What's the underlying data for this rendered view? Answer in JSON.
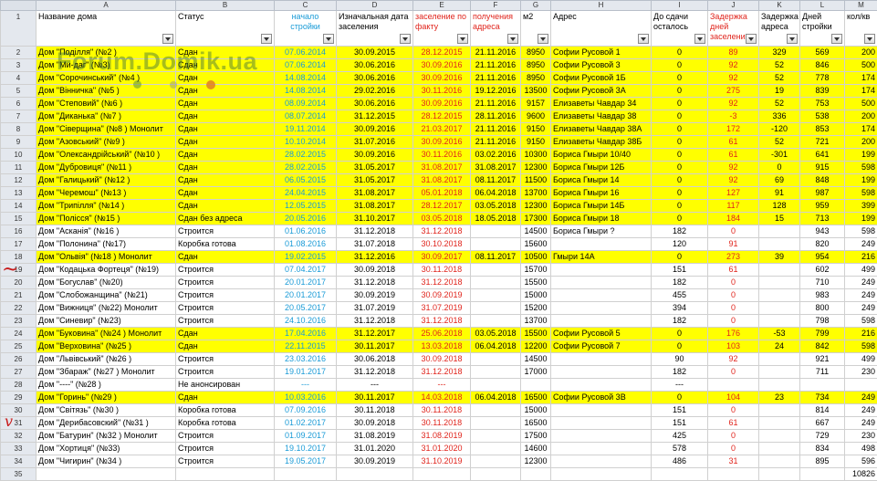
{
  "columns": [
    "A",
    "B",
    "C",
    "D",
    "E",
    "F",
    "G",
    "H",
    "I",
    "J",
    "K",
    "L",
    "M"
  ],
  "headers": [
    "Название дома",
    "Статус",
    "начало стройки",
    "Изначальная дата заселения",
    "заселение по факту",
    "получения адреса",
    "м2",
    "Адрес",
    "До сдачи осталось",
    "Задержка дней заселения",
    "Задержка адреса",
    "Дней стройки",
    "кол/кв"
  ],
  "header_row_number": "1",
  "rows": [
    {
      "n": "2",
      "hl": true,
      "c": [
        "Дом \"Поділля\" (№2 )",
        "Сдан",
        "07.06.2014",
        "30.09.2015",
        "28.12.2015",
        "21.11.2016",
        "8950",
        "Софии Русовой 1",
        "0",
        "89",
        "329",
        "569",
        "200"
      ]
    },
    {
      "n": "3",
      "hl": true,
      "c": [
        "Дом \"Ми-даг\" (№3)",
        "Сдан",
        "07.06.2014",
        "30.06.2016",
        "30.09.2016",
        "21.11.2016",
        "8950",
        "Софии Русовой 3",
        "0",
        "92",
        "52",
        "846",
        "500"
      ]
    },
    {
      "n": "4",
      "hl": true,
      "c": [
        "Дом \"Сорочинський\" (№4 )",
        "Сдан",
        "14.08.2014",
        "30.06.2016",
        "30.09.2016",
        "21.11.2016",
        "8950",
        "Софии Русовой 1Б",
        "0",
        "92",
        "52",
        "778",
        "174"
      ]
    },
    {
      "n": "5",
      "hl": true,
      "c": [
        "Дом \"Вінничка\" (№5 )",
        "Сдан",
        "14.08.2014",
        "29.02.2016",
        "30.11.2016",
        "19.12.2016",
        "13500",
        "Софии Русовой 3А",
        "0",
        "275",
        "19",
        "839",
        "174"
      ]
    },
    {
      "n": "6",
      "hl": true,
      "c": [
        "Дом \"Степовий\" (№6 )",
        "Сдан",
        "08.09.2014",
        "30.06.2016",
        "30.09.2016",
        "21.11.2016",
        "9157",
        "Елизаветы Чавдар 34",
        "0",
        "92",
        "52",
        "753",
        "500"
      ]
    },
    {
      "n": "7",
      "hl": true,
      "c": [
        "Дом \"Диканька\" (№7 )",
        "Сдан",
        "08.07.2014",
        "31.12.2015",
        "28.12.2015",
        "28.11.2016",
        "9600",
        "Елизаветы Чавдар 38",
        "0",
        "-3",
        "336",
        "538",
        "200"
      ]
    },
    {
      "n": "8",
      "hl": true,
      "c": [
        "Дом \"Сіверщина\" (№8 ) Монолит",
        "Сдан",
        "19.11.2014",
        "30.09.2016",
        "21.03.2017",
        "21.11.2016",
        "9150",
        "Елизаветы Чавдар 38А",
        "0",
        "172",
        "-120",
        "853",
        "174"
      ]
    },
    {
      "n": "9",
      "hl": true,
      "c": [
        "Дом \"Азовський\" (№9 )",
        "Сдан",
        "10.10.2014",
        "31.07.2016",
        "30.09.2016",
        "21.11.2016",
        "9150",
        "Елизаветы Чавдар 38Б",
        "0",
        "61",
        "52",
        "721",
        "200"
      ]
    },
    {
      "n": "10",
      "hl": true,
      "c": [
        "Дом \"Олександрійський\" (№10 )",
        "Сдан",
        "28.02.2015",
        "30.09.2016",
        "30.11.2016",
        "03.02.2016",
        "10300",
        "Бориса Гмыри 10/40",
        "0",
        "61",
        "-301",
        "641",
        "199"
      ]
    },
    {
      "n": "11",
      "hl": true,
      "c": [
        "Дом \"Дубровиця\" (№11 )",
        "Сдан",
        "28.02.2015",
        "31.05.2017",
        "31.08.2017",
        "31.08.2017",
        "12300",
        "Бориса Гмыри 12Б",
        "0",
        "92",
        "0",
        "915",
        "598"
      ]
    },
    {
      "n": "12",
      "hl": true,
      "c": [
        "Дом \"Галицький\" (№12 )",
        "Сдан",
        "06.05.2015",
        "31.05.2017",
        "31.08.2017",
        "08.11.2017",
        "11500",
        "Бориса Гмыри 14",
        "0",
        "92",
        "69",
        "848",
        "199"
      ]
    },
    {
      "n": "13",
      "hl": true,
      "c": [
        "Дом \"Черемош\" (№13 )",
        "Сдан",
        "24.04.2015",
        "31.08.2017",
        "05.01.2018",
        "06.04.2018",
        "13700",
        "Бориса Гмыри 16",
        "0",
        "127",
        "91",
        "987",
        "598"
      ]
    },
    {
      "n": "14",
      "hl": true,
      "c": [
        "Дом \"Трипілля\" (№14 )",
        "Сдан",
        "12.05.2015",
        "31.08.2017",
        "28.12.2017",
        "03.05.2018",
        "12300",
        "Бориса Гмыри 14Б",
        "0",
        "117",
        "128",
        "959",
        "399"
      ]
    },
    {
      "n": "15",
      "hl": true,
      "c": [
        "Дом \"Полісся\" (№15 )",
        "Сдан без адреса",
        "20.05.2016",
        "31.10.2017",
        "03.05.2018",
        "18.05.2018",
        "17300",
        "Бориса Гмыри 18",
        "0",
        "184",
        "15",
        "713",
        "199"
      ]
    },
    {
      "n": "16",
      "hl": false,
      "c": [
        "Дом \"Асканія\" (№16 )",
        "Строится",
        "01.06.2016",
        "31.12.2018",
        "31.12.2018",
        "",
        "14500",
        "Бориса Гмыри ?",
        "182",
        "0",
        "",
        "943",
        "598"
      ]
    },
    {
      "n": "17",
      "hl": false,
      "c": [
        "Дом \"Полонина\" (№17)",
        "Коробка готова",
        "01.08.2016",
        "31.07.2018",
        "30.10.2018",
        "",
        "15600",
        "",
        "120",
        "91",
        "",
        "820",
        "249"
      ]
    },
    {
      "n": "18",
      "hl": true,
      "c": [
        "Дом \"Ольвія\" (№18 ) Монолит",
        "Сдан",
        "19.02.2015",
        "31.12.2016",
        "30.09.2017",
        "08.11.2017",
        "10500",
        "Гмыри 14А",
        "0",
        "273",
        "39",
        "954",
        "216"
      ]
    },
    {
      "n": "19",
      "hl": false,
      "c": [
        "Дом \"Кодацька Фортеця\" (№19)",
        "Строится",
        "07.04.2017",
        "30.09.2018",
        "30.11.2018",
        "",
        "15700",
        "",
        "151",
        "61",
        "",
        "602",
        "499"
      ]
    },
    {
      "n": "20",
      "hl": false,
      "c": [
        "Дом \"Богуслав\" (№20)",
        "Строится",
        "20.01.2017",
        "31.12.2018",
        "31.12.2018",
        "",
        "15500",
        "",
        "182",
        "0",
        "",
        "710",
        "249"
      ]
    },
    {
      "n": "21",
      "hl": false,
      "c": [
        "Дом \"Слобожанщина\" (№21)",
        "Строится",
        "20.01.2017",
        "30.09.2019",
        "30.09.2019",
        "",
        "15000",
        "",
        "455",
        "0",
        "",
        "983",
        "249"
      ]
    },
    {
      "n": "22",
      "hl": false,
      "c": [
        "Дом \"Вижниця\" (№22) Монолит",
        "Строится",
        "20.05.2017",
        "31.07.2019",
        "31.07.2019",
        "",
        "15200",
        "",
        "394",
        "0",
        "",
        "800",
        "249"
      ]
    },
    {
      "n": "23",
      "hl": false,
      "c": [
        "Дом \"Синевир\" (№23)",
        "Строится",
        "24.10.2016",
        "31.12.2018",
        "31.12.2018",
        "",
        "13700",
        "",
        "182",
        "0",
        "",
        "798",
        "598"
      ]
    },
    {
      "n": "24",
      "hl": true,
      "c": [
        "Дом \"Буковина\" (№24 ) Монолит",
        "Сдан",
        "17.04.2016",
        "31.12.2017",
        "25.06.2018",
        "03.05.2018",
        "15500",
        "Софии Русовой 5",
        "0",
        "176",
        "-53",
        "799",
        "216"
      ]
    },
    {
      "n": "25",
      "hl": true,
      "c": [
        "Дом \"Верховина\" (№25 )",
        "Сдан",
        "22.11.2015",
        "30.11.2017",
        "13.03.2018",
        "06.04.2018",
        "12200",
        "Софии Русовой 7",
        "0",
        "103",
        "24",
        "842",
        "598"
      ]
    },
    {
      "n": "26",
      "hl": false,
      "c": [
        "Дом \"Львівський\" (№26 )",
        "Строится",
        "23.03.2016",
        "30.06.2018",
        "30.09.2018",
        "",
        "14500",
        "",
        "90",
        "92",
        "",
        "921",
        "499"
      ]
    },
    {
      "n": "27",
      "hl": false,
      "c": [
        "Дом \"Збараж\" (№27 ) Монолит",
        "Строится",
        "19.01.2017",
        "31.12.2018",
        "31.12.2018",
        "",
        "17000",
        "",
        "182",
        "0",
        "",
        "711",
        "230"
      ]
    },
    {
      "n": "28",
      "hl": false,
      "c": [
        "Дом \"----\" (№28 )",
        "Не анонсирован",
        "---",
        "---",
        "---",
        "",
        "",
        "",
        "---",
        "",
        "",
        "",
        ""
      ]
    },
    {
      "n": "29",
      "hl": true,
      "c": [
        "Дом \"Горинь\" (№29 )",
        "Сдан",
        "10.03.2016",
        "30.11.2017",
        "14.03.2018",
        "06.04.2018",
        "16500",
        "Софии Русовой 3В",
        "0",
        "104",
        "23",
        "734",
        "249"
      ]
    },
    {
      "n": "30",
      "hl": false,
      "c": [
        "Дом \"Світязь\" (№30 )",
        "Коробка готова",
        "07.09.2016",
        "30.11.2018",
        "30.11.2018",
        "",
        "15000",
        "",
        "151",
        "0",
        "",
        "814",
        "249"
      ]
    },
    {
      "n": "31",
      "hl": false,
      "c": [
        "Дом \"Дерибасовский\" (№31 )",
        "Коробка готова",
        "01.02.2017",
        "30.09.2018",
        "30.11.2018",
        "",
        "16500",
        "",
        "151",
        "61",
        "",
        "667",
        "249"
      ]
    },
    {
      "n": "32",
      "hl": false,
      "c": [
        "Дом \"Батурин\" (№32 ) Монолит",
        "Строится",
        "01.09.2017",
        "31.08.2019",
        "31.08.2019",
        "",
        "17500",
        "",
        "425",
        "0",
        "",
        "729",
        "230"
      ]
    },
    {
      "n": "33",
      "hl": false,
      "c": [
        "Дом \"Хортиця\" (№33)",
        "Строится",
        "19.10.2017",
        "31.01.2020",
        "31.01.2020",
        "",
        "14600",
        "",
        "578",
        "0",
        "",
        "834",
        "498"
      ]
    },
    {
      "n": "34",
      "hl": false,
      "c": [
        "Дом \"Чигирин\" (№34 )",
        "Строится",
        "19.05.2017",
        "30.09.2019",
        "31.10.2019",
        "",
        "12300",
        "",
        "486",
        "31",
        "",
        "895",
        "596"
      ]
    },
    {
      "n": "35",
      "hl": false,
      "c": [
        "",
        "",
        "",
        "",
        "",
        "",
        "",
        "",
        "",
        "",
        "",
        "",
        "10826"
      ]
    }
  ],
  "watermark": "Forum.Domik.ua",
  "annotations": {
    "mark_row_18": "~",
    "mark_row_31": "v"
  },
  "colors": {
    "highlight": "#ffff00",
    "blue_text": "#1a9bd7",
    "red_text": "#e0241c",
    "header_bg": "#e4e8ee"
  }
}
